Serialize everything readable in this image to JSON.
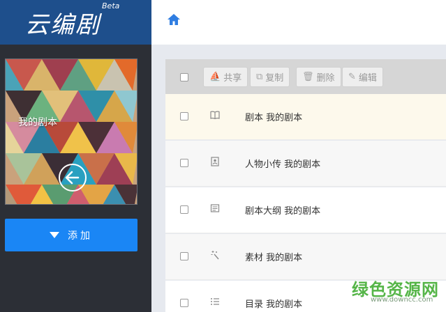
{
  "brand": {
    "logo_text": "云编剧",
    "badge": "Beta"
  },
  "sidebar": {
    "cover_title": "我的剧本",
    "add_label": "添加"
  },
  "header": {
    "home_icon": "home-icon"
  },
  "toolbar": {
    "share_label": "共享",
    "copy_label": "复制",
    "delete_label": "删除",
    "edit_label": "编辑"
  },
  "rows": [
    {
      "icon": "book-icon",
      "name": "剧本 我的剧本"
    },
    {
      "icon": "contact-card-icon",
      "name": "人物小传 我的剧本"
    },
    {
      "icon": "outline-icon",
      "name": "剧本大纲 我的剧本"
    },
    {
      "icon": "magic-wand-icon",
      "name": "素材 我的剧本"
    },
    {
      "icon": "list-icon",
      "name": "目录 我的剧本"
    }
  ],
  "watermark": {
    "text": "绿色资源网",
    "url_text": "www.downcc.com"
  },
  "colors": {
    "brand_bg": "#1e4f8c",
    "sidebar_bg": "#2c2f36",
    "accent": "#1a86f5",
    "highlight_row": "#fdf9ec",
    "watermark": "#55b548"
  }
}
